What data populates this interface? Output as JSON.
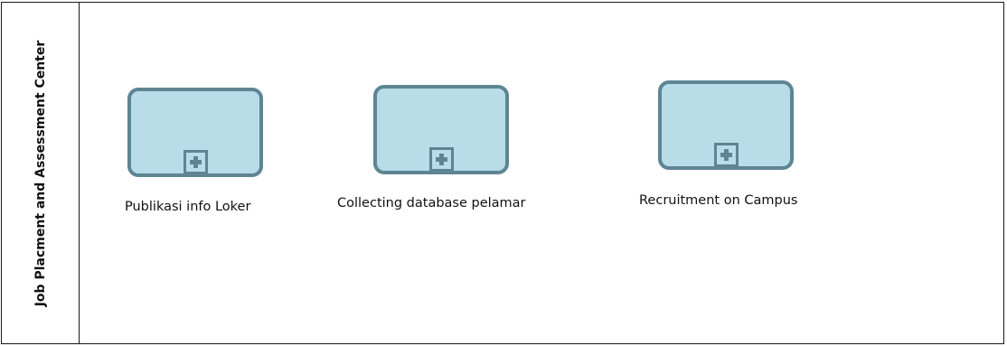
{
  "lane": {
    "title": "Job Placment and Assessment Center"
  },
  "tasks": [
    {
      "label": "Publikasi info Loker",
      "icon": "plus-icon"
    },
    {
      "label": "Collecting database pelamar",
      "icon": "plus-icon"
    },
    {
      "label": "Recruitment on Campus",
      "icon": "plus-icon"
    }
  ],
  "colors": {
    "task_fill": "#b9dde8",
    "task_border": "#5e8593",
    "line": "#1a1a1a"
  }
}
